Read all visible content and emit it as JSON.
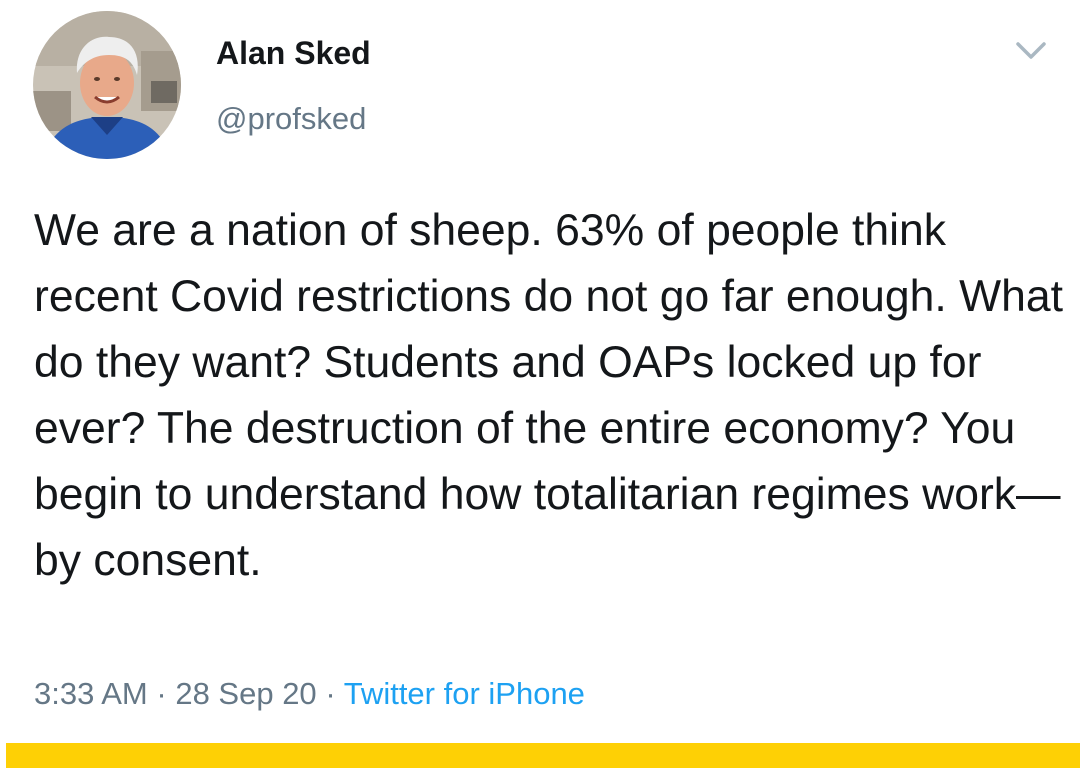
{
  "user": {
    "display_name": "Alan Sked",
    "handle": "@profsked"
  },
  "tweet": {
    "text": "We are a nation of sheep. 63% of people think recent Covid restrictions do not go far enough. What do they want? Students and OAPs locked up for ever? The destruction of the entire economy? You begin to understand how totalitarian regimes work— by consent.",
    "time": "3:33 AM",
    "date": "28 Sep 20",
    "separator": "·",
    "source": "Twitter for iPhone"
  },
  "icons": {
    "menu": "chevron-down-icon",
    "avatar": "profile-photo"
  },
  "colors": {
    "text": "#14171a",
    "muted": "#657786",
    "link": "#1da1f2",
    "bottom_bar": "#fed005"
  }
}
